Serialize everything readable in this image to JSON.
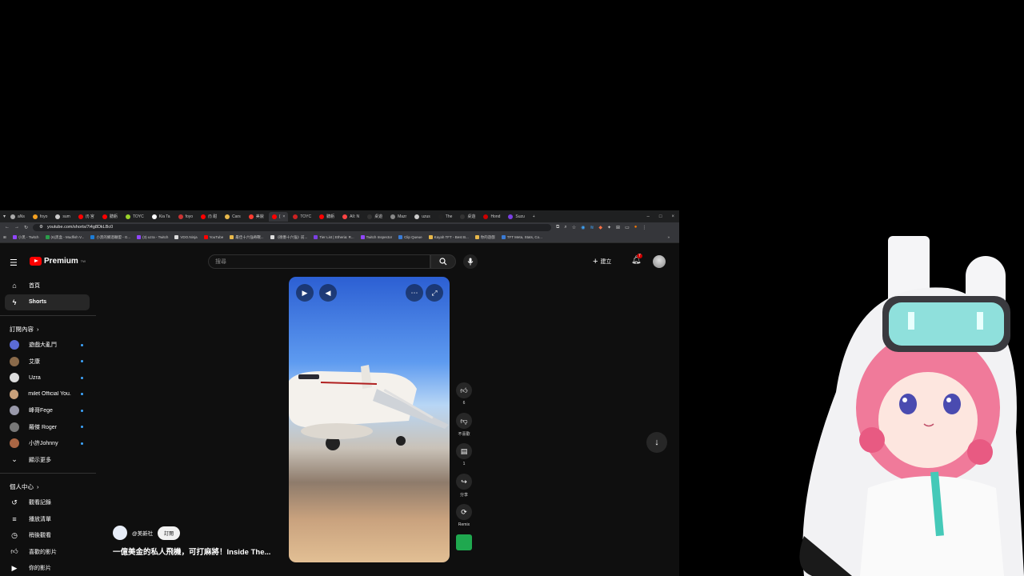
{
  "browser": {
    "tabs": [
      {
        "label": "aNs",
        "color": "#aaaaaa"
      },
      {
        "label": "foyo",
        "color": "#f4a020"
      },
      {
        "label": "sum",
        "color": "#cccccc"
      },
      {
        "label": "(f) 宮",
        "color": "#ff0000"
      },
      {
        "label": "聽虧",
        "color": "#ff0000"
      },
      {
        "label": "TOYC",
        "color": "#9ad32a"
      },
      {
        "label": "Kia Ta",
        "color": "#ffffff"
      },
      {
        "label": "foyo",
        "color": "#cc3333"
      },
      {
        "label": "(f) 甜",
        "color": "#ff0000"
      },
      {
        "label": "Cars",
        "color": "#e8b84a"
      },
      {
        "label": "美貌",
        "color": "#ff3b30"
      },
      {
        "label": "(",
        "color": "#ff0000",
        "active": true
      },
      {
        "label": "TOYC",
        "color": "#cc2222"
      },
      {
        "label": "聽虧",
        "color": "#ff0000"
      },
      {
        "label": "All: N",
        "color": "#ff4444"
      },
      {
        "label": "桌遊",
        "color": "#333333"
      },
      {
        "label": "Mazr",
        "color": "#888888"
      },
      {
        "label": "uzus",
        "color": "#cccccc"
      },
      {
        "label": "The",
        "color": "#222222"
      },
      {
        "label": "桌遊",
        "color": "#333333"
      },
      {
        "label": "Hond",
        "color": "#cc0000"
      },
      {
        "label": "Suzu",
        "color": "#7b3fe4"
      }
    ],
    "new_tab": "+",
    "window_controls": [
      "–",
      "□",
      "×"
    ],
    "url": "youtube.com/shorts/7i4g8DkLBc0",
    "bookmarks": [
      {
        "label": "小黑 - Twitch",
        "color": "#9146ff"
      },
      {
        "label": "(6)黑盒 - Mudfish V...",
        "color": "#2a9d4a"
      },
      {
        "label": "小黑的鄉酒聯盟 - G...",
        "color": "#1c7cd6"
      },
      {
        "label": "(3) uzra - Twitch",
        "color": "#9146ff"
      },
      {
        "label": "VDO.Ninja",
        "color": "#dddddd"
      },
      {
        "label": "YouTube",
        "color": "#ff0000"
      },
      {
        "label": "最佳十六強奇戰...",
        "color": "#e8b84a"
      },
      {
        "label": "《德墨十六強》前...",
        "color": "#dddddd"
      },
      {
        "label": "Tier List | Etheria: R...",
        "color": "#7b3fe4"
      },
      {
        "label": "Twitch Inspector",
        "color": "#9146ff"
      },
      {
        "label": "Clip Queue",
        "color": "#3a7bd5"
      },
      {
        "label": "Kayah TFT - Best B...",
        "color": "#e8b84a"
      },
      {
        "label": "你的遊戲",
        "color": "#e8b84a"
      },
      {
        "label": "TFT Meta, Stats, Co...",
        "color": "#3a7bd5"
      }
    ]
  },
  "youtube": {
    "logo_text": "Premium",
    "logo_region": "TW",
    "search_placeholder": "搜尋",
    "create_label": "建立",
    "notifications_count": "7",
    "sidebar": {
      "home": "首頁",
      "shorts": "Shorts",
      "subscriptions_header": "訂閱內容",
      "subscriptions": [
        {
          "name": "遊戲大亂鬥",
          "color": "#5b6bd6"
        },
        {
          "name": "艾康",
          "color": "#8a6a4a"
        },
        {
          "name": "Uzra",
          "color": "#dddddd"
        },
        {
          "name": "milet Official You...",
          "color": "#c9a07a"
        },
        {
          "name": "峰哥Fege",
          "color": "#9999aa"
        },
        {
          "name": "羅傑 Roger",
          "color": "#777777"
        },
        {
          "name": "小許Johnny",
          "color": "#aa6644"
        }
      ],
      "show_more": "顯示更多",
      "you_header": "個人中心",
      "you_items": [
        "觀看記錄",
        "播放清單",
        "稍後觀看",
        "喜歡的影片",
        "你的影片"
      ]
    },
    "actions": {
      "likes": "6",
      "dislike_label": "不喜歡",
      "comments": "1",
      "share_label": "分享",
      "remix_label": "Remix"
    },
    "video": {
      "channel": "@美新社",
      "subscribe_label": "訂閱",
      "title": "一億美金的私人飛機，可打麻將！Inside The..."
    }
  }
}
